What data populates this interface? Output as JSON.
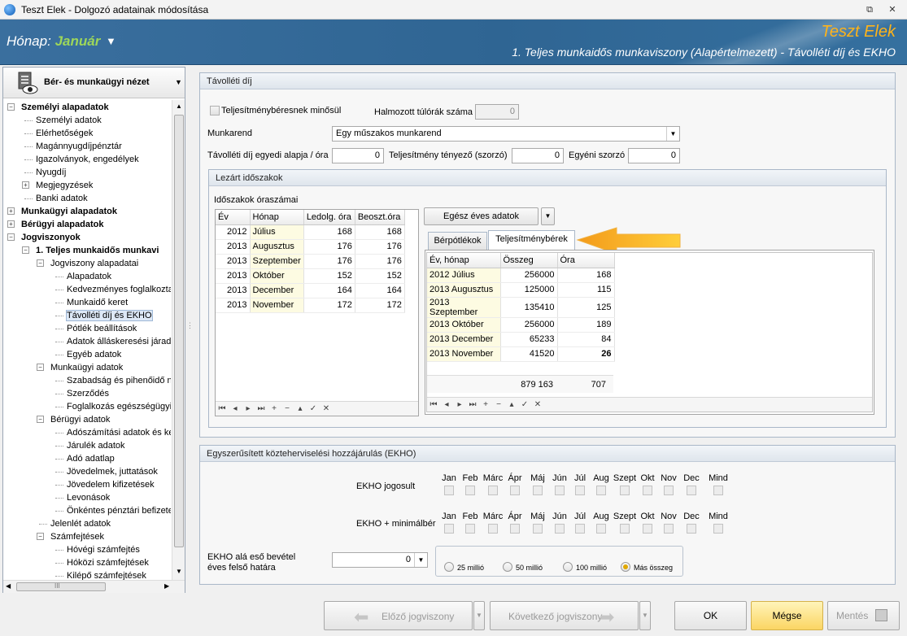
{
  "window": {
    "title": "Teszt Elek - Dolgozó adatainak módosítása"
  },
  "banner": {
    "month_label": "Hónap:",
    "month_value": "Január",
    "person": "Teszt Elek",
    "subtitle": "1. Teljes munkaidős munkaviszony (Alapértelmezett) - Távolléti díj és EKHO"
  },
  "nav": {
    "header": "Bér- és munkaügyi nézet",
    "tree": [
      "Személyi alapadatok",
      "Személyi adatok",
      "Elérhetőségek",
      "Magánnyugdíjpénztár",
      "Igazolványok, engedélyek",
      "Nyugdíj",
      "Megjegyzések",
      "Banki adatok",
      "Munkaügyi alapadatok",
      "Bérügyi alapadatok",
      "Jogviszonyok",
      "1. Teljes munkaidős munkavi",
      "Jogviszony alapadatai",
      "Alapadatok",
      "Kedvezményes foglalkozta",
      "Munkaidő keret",
      "Távolléti díj és EKHO",
      "Pótlék beállítások",
      "Adatok álláskeresési járade",
      "Egyéb adatok",
      "Munkaügyi adatok",
      "Szabadság és pihenőidő ny",
      "Szerződés",
      "Foglalkozás egészségügyi a",
      "Bérügyi adatok",
      "Adószámítási adatok és ke",
      "Járulék adatok",
      "Adó adatlap",
      "Jövedelmek, juttatások",
      "Jövedelem kifizetések",
      "Levonások",
      "Önkéntes pénztári befizete",
      "Jelenlét adatok",
      "Számfejtések",
      "Hóvégi számfejtés",
      "Hóközi számfejtések",
      "Kilépő számfejtések"
    ],
    "hscroll_grip": "III"
  },
  "tavolleti": {
    "title": "Távolléti díj",
    "teljesitmeny_label": "Teljesítménybéresnek minősül",
    "halmozott_label": "Halmozott túlórák száma",
    "halmozott_value": "0",
    "munkarend_label": "Munkarend",
    "munkarend_value": "Egy műszakos munkarend",
    "alap_label": "Távolléti díj egyedi alapja / óra",
    "alap_value": "0",
    "tenyezo_label": "Teljesítmény tényező (szorzó)",
    "tenyezo_value": "0",
    "egyeni_label": "Egyéni szorzó",
    "egyeni_value": "0"
  },
  "lezart": {
    "title": "Lezárt időszakok",
    "grid_title": "Időszakok óraszámai",
    "columns": [
      "Év",
      "Hónap",
      "Ledolg. óra",
      "Beoszt.óra"
    ],
    "rows": [
      [
        "2012",
        "Július",
        "168",
        "168"
      ],
      [
        "2013",
        "Augusztus",
        "176",
        "176"
      ],
      [
        "2013",
        "Szeptember",
        "176",
        "176"
      ],
      [
        "2013",
        "Október",
        "152",
        "152"
      ],
      [
        "2013",
        "December",
        "164",
        "164"
      ],
      [
        "2013",
        "November",
        "172",
        "172"
      ]
    ],
    "eves_button": "Egész éves adatok",
    "tabs": [
      "Bérpótlékok",
      "Teljesítménybérek"
    ],
    "perf_columns": [
      "Év, hónap",
      "Összeg",
      "Óra"
    ],
    "perf_rows": [
      [
        "2012 Július",
        "256000",
        "168"
      ],
      [
        "2013 Augusztus",
        "125000",
        "115"
      ],
      [
        "2013 Szeptember",
        "135410",
        "125"
      ],
      [
        "2013 Október",
        "256000",
        "189"
      ],
      [
        "2013 December",
        "65233",
        "84"
      ],
      [
        "2013 November",
        "41520",
        "26"
      ]
    ],
    "perf_sum_osszeg": "879 163",
    "perf_sum_ora": "707"
  },
  "ekho": {
    "title": "Egyszerűsített közteherviselési hozzájárulás (EKHO)",
    "months": [
      "Jan",
      "Feb",
      "Márc",
      "Ápr",
      "Máj",
      "Jún",
      "Júl",
      "Aug",
      "Szept",
      "Okt",
      "Nov",
      "Dec",
      "Mind"
    ],
    "row1_label": "EKHO jogosult",
    "row2_label": "EKHO + minimálbér",
    "bevetel_label1": "EKHO alá eső bevétel",
    "bevetel_label2": "éves felső határa",
    "bevetel_value": "0",
    "radios": [
      "25 millió",
      "50 millió",
      "100 millió",
      "Más összeg"
    ],
    "radio_selected": "Más összeg"
  },
  "footer": {
    "prev": "Előző jogviszony",
    "next": "Következő jogviszony",
    "ok": "OK",
    "cancel": "Mégse",
    "save": "Mentés"
  }
}
